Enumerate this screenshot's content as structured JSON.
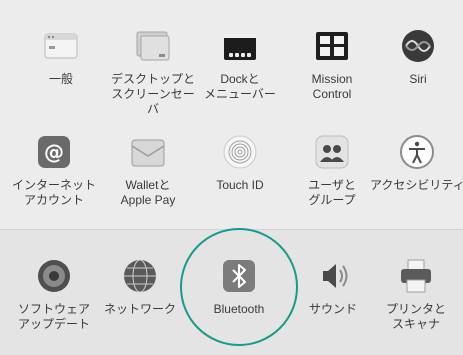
{
  "top_panes": [
    {
      "id": "general",
      "label": "一般",
      "icon": "general-icon"
    },
    {
      "id": "desktop",
      "label": "デスクトップと\nスクリーンセーバ",
      "icon": "desktop-screensaver-icon"
    },
    {
      "id": "dock",
      "label": "Dockと\nメニューバー",
      "icon": "dock-icon"
    },
    {
      "id": "mission",
      "label": "Mission\nControl",
      "icon": "mission-control-icon"
    },
    {
      "id": "siri",
      "label": "Siri",
      "icon": "siri-icon"
    },
    {
      "id": "internet",
      "label": "インターネット\nアカウント",
      "icon": "internet-accounts-icon"
    },
    {
      "id": "wallet",
      "label": "Walletと\nApple Pay",
      "icon": "wallet-icon"
    },
    {
      "id": "touchid",
      "label": "Touch ID",
      "icon": "fingerprint-icon"
    },
    {
      "id": "users",
      "label": "ユーザと\nグループ",
      "icon": "users-groups-icon"
    },
    {
      "id": "access",
      "label": "アクセシビリティ",
      "icon": "accessibility-icon"
    }
  ],
  "bottom_panes": [
    {
      "id": "swupdate",
      "label": "ソフトウェア\nアップデート",
      "icon": "software-update-icon"
    },
    {
      "id": "network",
      "label": "ネットワーク",
      "icon": "network-icon"
    },
    {
      "id": "bluetooth",
      "label": "Bluetooth",
      "icon": "bluetooth-icon"
    },
    {
      "id": "sound",
      "label": "サウンド",
      "icon": "sound-icon"
    },
    {
      "id": "printers",
      "label": "プリンタと\nスキャナ",
      "icon": "printer-icon"
    }
  ],
  "highlight": {
    "pane": "bluetooth",
    "color": "#189a8c"
  }
}
